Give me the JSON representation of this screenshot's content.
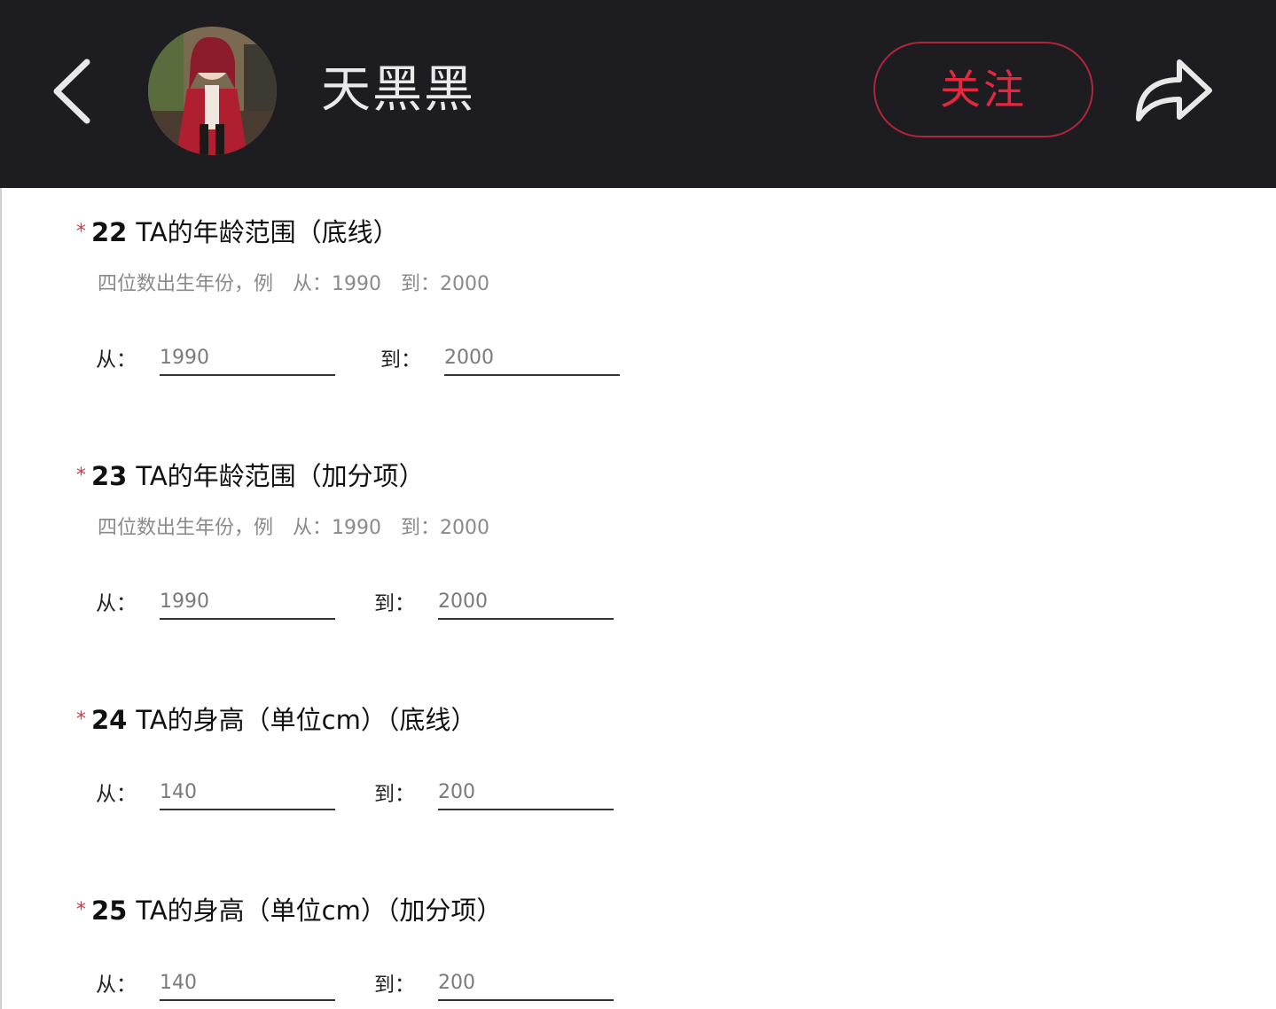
{
  "header": {
    "username": "天黑黑",
    "follow_label": "关注",
    "back_icon": "chevron-left-icon",
    "share_icon": "share-arrow-icon"
  },
  "questions": [
    {
      "required": "*",
      "number": "22",
      "title": "TA的年龄范围（底线）",
      "hint": "四位数出生年份，例　从：1990　到：2000",
      "from_label": "从：",
      "from_value": "1990",
      "to_label": "到：",
      "to_value": "2000"
    },
    {
      "required": "*",
      "number": "23",
      "title": "TA的年龄范围（加分项）",
      "hint": "四位数出生年份，例　从：1990　到：2000",
      "from_label": "从：",
      "from_value": "1990",
      "to_label": "到：",
      "to_value": "2000"
    },
    {
      "required": "*",
      "number": "24",
      "title": "TA的身高（单位cm）（底线）",
      "from_label": "从：",
      "from_value": "140",
      "to_label": "到：",
      "to_value": "200"
    },
    {
      "required": "*",
      "number": "25",
      "title": "TA的身高（单位cm）（加分项）",
      "from_label": "从：",
      "from_value": "140",
      "to_label": "到：",
      "to_value": "200"
    }
  ],
  "colors": {
    "topbar_bg": "#1d1c21",
    "accent_red": "#e6283f",
    "required_star": "#d6364a"
  }
}
